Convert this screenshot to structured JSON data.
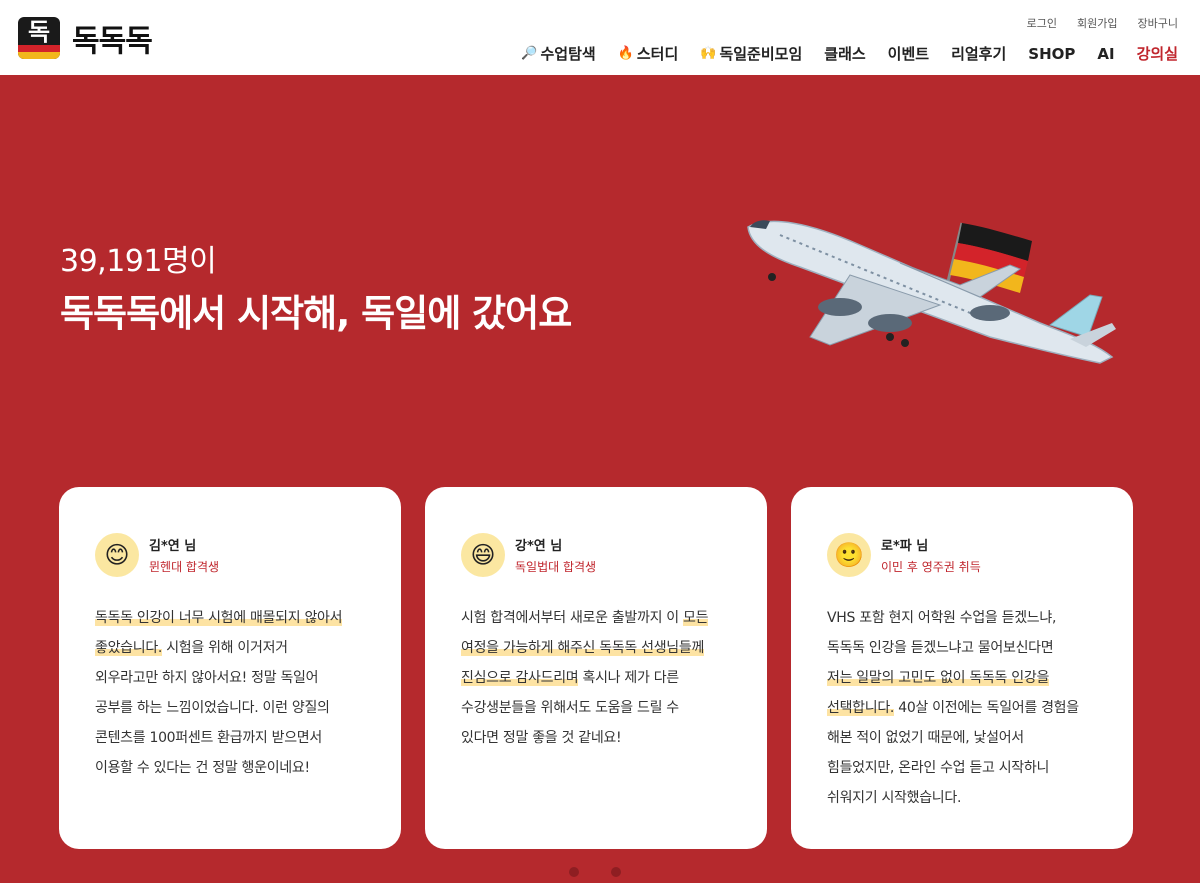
{
  "header": {
    "logo_glyph": "독",
    "logo_text": "독독독",
    "util": {
      "login": "로그인",
      "signup": "회원가입",
      "cart": "장바구니"
    },
    "nav": [
      {
        "label": "수업탐색",
        "icon": "🔎"
      },
      {
        "label": "스터디",
        "icon": "🔥"
      },
      {
        "label": "독일준비모임",
        "icon": "🙌"
      },
      {
        "label": "클래스"
      },
      {
        "label": "이벤트"
      },
      {
        "label": "리얼후기"
      },
      {
        "label": "SHOP"
      },
      {
        "label": "AI"
      },
      {
        "label": "강의실"
      }
    ]
  },
  "hero": {
    "count": "39,191명이",
    "title": "독독독에서 시작해, 독일에 갔어요"
  },
  "colors": {
    "brand_red": "#b5292d",
    "accent_red": "#c0262d",
    "highlight": "#fde3a3"
  },
  "reviews": [
    {
      "name": "김*연 님",
      "tag": "뮌헨대 합격생",
      "avatar_icon": "😊",
      "lines": [
        {
          "hl": "독독독 인강이 너무 시험에 매몰되지 않아서",
          "rest": ""
        },
        {
          "hl": "좋았습니다.",
          "rest": " 시험을 위해 이거저거"
        },
        {
          "hl": "",
          "rest": "외우라고만 하지 않아서요! 정말 독일어"
        },
        {
          "hl": "",
          "rest": "공부를 하는 느낌이었습니다. 이런 양질의"
        },
        {
          "hl": "",
          "rest": "콘텐츠를 100퍼센트 환급까지 받으면서"
        },
        {
          "hl": "",
          "rest": "이용할 수 있다는 건 정말 행운이네요!"
        }
      ]
    },
    {
      "name": "강*연 님",
      "tag": "독일법대 합격생",
      "avatar_icon": "😄",
      "lines": [
        {
          "pre": "시험 합격에서부터 새로운 출발까지 이 ",
          "hl": "모든",
          "rest": ""
        },
        {
          "pre": "",
          "hl": "여정을 가능하게 해주신 독독독 선생님들께",
          "rest": ""
        },
        {
          "pre": "",
          "hl": "진심으로 감사드리며",
          "rest": " 혹시나 제가 다른"
        },
        {
          "pre": "",
          "hl": "",
          "rest": "수강생분들을 위해서도 도움을 드릴 수"
        },
        {
          "pre": "",
          "hl": "",
          "rest": "있다면 정말 좋을 것 같네요!"
        }
      ]
    },
    {
      "name": "로*파 님",
      "tag": "이민 후 영주권 취득",
      "avatar_icon": "🙂",
      "lines": [
        {
          "hl": "",
          "rest": "VHS 포함 현지 어학원 수업을 듣겠느냐,"
        },
        {
          "hl": "",
          "rest": "독독독 인강을 듣겠느냐고 물어보신다면"
        },
        {
          "hl": "저는 일말의 고민도 없이 독독독 인강을",
          "rest": ""
        },
        {
          "hl": "선택합니다.",
          "rest": " 40살 이전에는 독일어를 경험을"
        },
        {
          "hl": "",
          "rest": "해본 적이 없었기 때문에, 낯설어서"
        },
        {
          "hl": "",
          "rest": "힘들었지만, 온라인 수업 듣고 시작하니"
        },
        {
          "hl": "",
          "rest": "쉬워지기 시작했습니다."
        }
      ]
    }
  ],
  "pager": {
    "count": 2
  }
}
